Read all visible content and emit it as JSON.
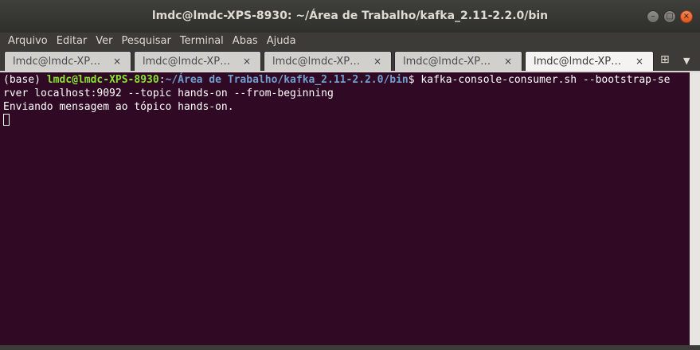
{
  "window": {
    "title": "lmdc@lmdc-XPS-8930: ~/Área de Trabalho/kafka_2.11-2.2.0/bin",
    "controls": {
      "minimize_glyph": "–",
      "maximize_glyph": "□",
      "close_glyph": "×"
    }
  },
  "menubar": {
    "items": [
      "Arquivo",
      "Editar",
      "Ver",
      "Pesquisar",
      "Terminal",
      "Abas",
      "Ajuda"
    ]
  },
  "tabs": [
    {
      "label": "lmdc@lmdc-XP…",
      "close": "×",
      "active": false
    },
    {
      "label": "lmdc@lmdc-XP…",
      "close": "×",
      "active": false
    },
    {
      "label": "lmdc@lmdc-XP…",
      "close": "×",
      "active": false
    },
    {
      "label": "lmdc@lmdc-XP…",
      "close": "×",
      "active": false
    },
    {
      "label": "lmdc@lmdc-XP…",
      "close": "×",
      "active": true
    }
  ],
  "tab_controls": {
    "new_tab_glyph": "⊞",
    "menu_glyph": "▼"
  },
  "terminal": {
    "prompt_prefix": "(base) ",
    "prompt_user": "lmdc@lmdc-XPS-8930",
    "prompt_sep": ":",
    "prompt_path": "~/Área de Trabalho/kafka_2.11-2.2.0/bin",
    "prompt_symbol": "$ ",
    "command_line1": "kafka-console-consumer.sh --bootstrap-se",
    "command_line2": "rver localhost:9092 --topic hands-on --from-beginning",
    "output_line": "Enviando mensagem ao tópico hands-on."
  },
  "colors": {
    "terminal_bg": "#300a24",
    "prompt_user": "#8ae234",
    "prompt_path": "#729fcf",
    "close_button": "#e95420"
  }
}
